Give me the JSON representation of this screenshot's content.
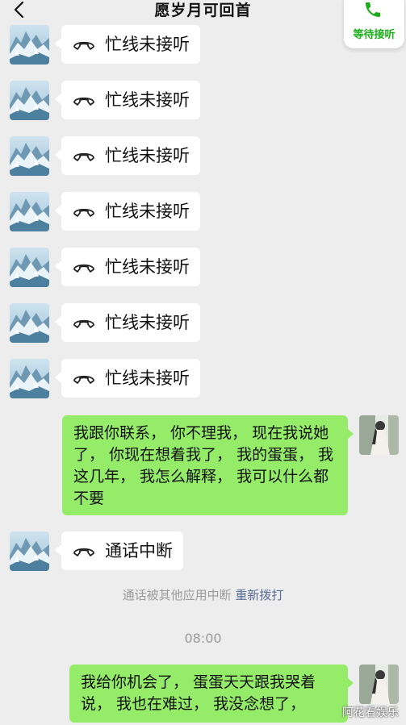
{
  "header": {
    "title": "愿岁月可回首",
    "float_label": "等待接听"
  },
  "calls": [
    {
      "label": "忙线未接听"
    },
    {
      "label": "忙线未接听"
    },
    {
      "label": "忙线未接听"
    },
    {
      "label": "忙线未接听"
    },
    {
      "label": "忙线未接听"
    },
    {
      "label": "忙线未接听"
    },
    {
      "label": "忙线未接听"
    }
  ],
  "messages": {
    "msg1": "我跟你联系， 你不理我， 现在我说她了， 你现在想着我了， 我的蛋蛋， 我这几年， 我怎么解释， 我可以什么都不要",
    "call_interrupted": "通话中断",
    "msg2": "我给你机会了， 蛋蛋天天跟我哭着说， 我也在难过， 我没念想了，"
  },
  "system": {
    "interrupted_text": "通话被其他应用中断",
    "redial": "重新拨打",
    "time": "08:00"
  },
  "watermark": "阿花看娱乐",
  "colors": {
    "background": "#ededed",
    "green_bubble": "#95ec69",
    "link": "#576b95",
    "call_green": "#1aad19"
  },
  "icons": [
    "back-arrow-icon",
    "phone-icon",
    "phone-hangup-icon"
  ]
}
